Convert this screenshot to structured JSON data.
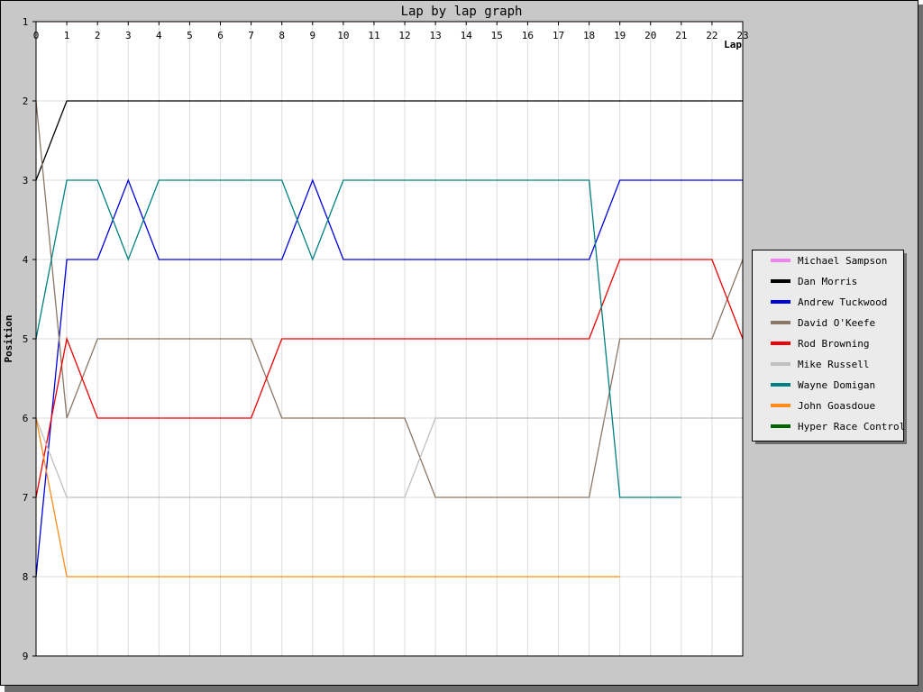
{
  "chart_data": {
    "type": "line",
    "title": "Lap by lap graph",
    "xlabel": "Lap",
    "ylabel": "Position",
    "xlim": [
      0,
      23
    ],
    "ylim": [
      1,
      9
    ],
    "y_inverted": true,
    "x_ticks": [
      "0",
      "1",
      "2",
      "3",
      "4",
      "5",
      "6",
      "7",
      "8",
      "9",
      "10",
      "11",
      "12",
      "13",
      "14",
      "15",
      "16",
      "17",
      "18",
      "19",
      "20",
      "21",
      "22",
      "23"
    ],
    "y_ticks": [
      "1",
      "2",
      "3",
      "4",
      "5",
      "6",
      "7",
      "8",
      "9"
    ],
    "grid": true,
    "legend_position": "right",
    "series": [
      {
        "name": "Michael Sampson",
        "color": "#ee82ee",
        "x": [
          0,
          1,
          2,
          3,
          4,
          5,
          6,
          7,
          8,
          9,
          10,
          11,
          12,
          13,
          14,
          15,
          16,
          17,
          18,
          19,
          20,
          21,
          22,
          23
        ],
        "y": [
          1,
          1,
          1,
          1,
          1,
          1,
          1,
          1,
          1,
          1,
          1,
          1,
          1,
          1,
          1,
          1,
          1,
          1,
          1,
          1,
          1,
          1,
          1,
          1
        ]
      },
      {
        "name": "Dan Morris",
        "color": "#000000",
        "x": [
          0,
          1,
          2,
          3,
          4,
          5,
          6,
          7,
          8,
          9,
          10,
          11,
          12,
          13,
          14,
          15,
          16,
          17,
          18,
          19,
          20,
          21,
          22,
          23
        ],
        "y": [
          3,
          2,
          2,
          2,
          2,
          2,
          2,
          2,
          2,
          2,
          2,
          2,
          2,
          2,
          2,
          2,
          2,
          2,
          2,
          2,
          2,
          2,
          2,
          2
        ]
      },
      {
        "name": "Andrew Tuckwood",
        "color": "#0000dd",
        "x": [
          0,
          1,
          2,
          3,
          4,
          5,
          6,
          7,
          8,
          9,
          10,
          11,
          12,
          13,
          14,
          15,
          16,
          17,
          18,
          19,
          20,
          21,
          22,
          23
        ],
        "y": [
          8,
          4,
          4,
          3,
          4,
          4,
          4,
          4,
          4,
          3,
          4,
          4,
          4,
          4,
          4,
          4,
          4,
          4,
          4,
          3,
          3,
          3,
          3,
          3
        ]
      },
      {
        "name": "David O'Keefe",
        "color": "#8b7765",
        "x": [
          0,
          1,
          2,
          3,
          4,
          5,
          6,
          7,
          8,
          9,
          10,
          11,
          12,
          13,
          14,
          15,
          16,
          17,
          18,
          19,
          20,
          21,
          22,
          23
        ],
        "y": [
          2,
          6,
          5,
          5,
          5,
          5,
          5,
          5,
          6,
          6,
          6,
          6,
          6,
          7,
          7,
          7,
          7,
          7,
          7,
          5,
          5,
          5,
          5,
          4
        ]
      },
      {
        "name": "Rod Browning",
        "color": "#ee0000",
        "x": [
          0,
          1,
          2,
          3,
          4,
          5,
          6,
          7,
          8,
          9,
          10,
          11,
          12,
          13,
          14,
          15,
          16,
          17,
          18,
          19,
          20,
          21,
          22,
          23
        ],
        "y": [
          7,
          5,
          6,
          6,
          6,
          6,
          6,
          6,
          5,
          5,
          5,
          5,
          5,
          5,
          5,
          5,
          5,
          5,
          5,
          4,
          4,
          4,
          4,
          5
        ]
      },
      {
        "name": "Mike Russell",
        "color": "#c0c0c0",
        "x": [
          0,
          1,
          2,
          3,
          4,
          5,
          6,
          7,
          8,
          9,
          10,
          11,
          12,
          13,
          14,
          15,
          16,
          17,
          18,
          19,
          20,
          21,
          22,
          23
        ],
        "y": [
          6,
          7,
          7,
          7,
          7,
          7,
          7,
          7,
          7,
          7,
          7,
          7,
          7,
          6,
          6,
          6,
          6,
          6,
          6,
          6,
          6,
          6,
          6,
          6
        ]
      },
      {
        "name": "Wayne Domigan",
        "color": "#008080",
        "x": [
          0,
          1,
          2,
          3,
          4,
          5,
          6,
          7,
          8,
          9,
          10,
          11,
          12,
          13,
          14,
          15,
          16,
          17,
          18,
          19,
          20,
          21
        ],
        "y": [
          5,
          3,
          3,
          4,
          3,
          3,
          3,
          3,
          3,
          4,
          3,
          3,
          3,
          3,
          3,
          3,
          3,
          3,
          3,
          7,
          7,
          7
        ]
      },
      {
        "name": "John Goasdoue",
        "color": "#ff8c1a",
        "x": [
          0,
          1,
          2,
          3,
          4,
          5,
          6,
          7,
          8,
          9,
          10,
          11,
          12,
          13,
          14,
          15,
          16,
          17,
          18,
          19
        ],
        "y": [
          6,
          8,
          8,
          8,
          8,
          8,
          8,
          8,
          8,
          8,
          8,
          8,
          8,
          8,
          8,
          8,
          8,
          8,
          8,
          8
        ]
      },
      {
        "name": "Hyper Race Control",
        "color": "#006400",
        "x": [],
        "y": []
      }
    ]
  }
}
